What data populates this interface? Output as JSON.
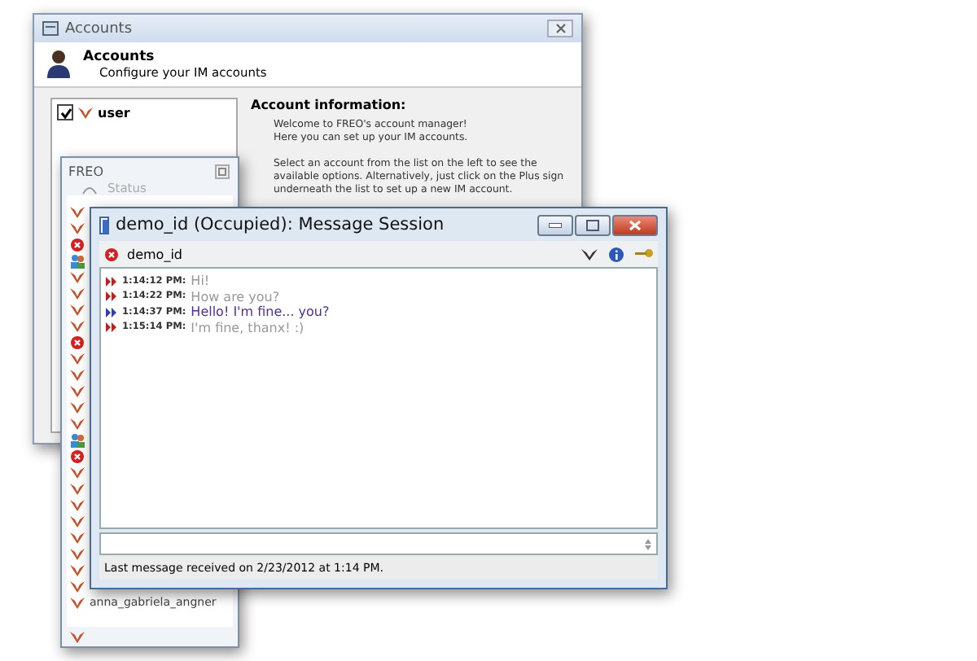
{
  "accounts_window": {
    "title": "Accounts",
    "header_title": "Accounts",
    "header_subtitle": "Configure your IM accounts",
    "accounts": [
      {
        "name": "user",
        "checked": true
      }
    ],
    "info_heading": "Account information:",
    "info_paragraphs": [
      "Welcome to FREO's account manager!\nHere you can set up your IM accounts.",
      "Select an account from the list on the left to see the available options. Alternatively, just click on the Plus sign underneath the list to set up a new IM account."
    ]
  },
  "contact_window": {
    "title": "FREO",
    "status_label": "Status",
    "contacts": [
      {
        "kind": "online"
      },
      {
        "kind": "online"
      },
      {
        "kind": "busy"
      },
      {
        "kind": "group"
      },
      {
        "kind": "online"
      },
      {
        "kind": "online"
      },
      {
        "kind": "online"
      },
      {
        "kind": "online"
      },
      {
        "kind": "busy"
      },
      {
        "kind": "online"
      },
      {
        "kind": "online"
      },
      {
        "kind": "online"
      },
      {
        "kind": "online"
      },
      {
        "kind": "online"
      },
      {
        "kind": "group"
      },
      {
        "kind": "busy"
      },
      {
        "kind": "online"
      },
      {
        "kind": "online"
      },
      {
        "kind": "online"
      },
      {
        "kind": "online"
      },
      {
        "kind": "online"
      },
      {
        "kind": "online"
      },
      {
        "kind": "online"
      },
      {
        "kind": "online"
      },
      {
        "kind": "online",
        "name": "anna_gabriela_angner"
      }
    ]
  },
  "chat_window": {
    "title": "demo_id (Occupied): Message Session",
    "contact": "demo_id",
    "messages": [
      {
        "kind": "in",
        "time": "1:14:12 PM:",
        "text": "Hi!"
      },
      {
        "kind": "in",
        "time": "1:14:22 PM:",
        "text": "How are you?"
      },
      {
        "kind": "out",
        "time": "1:14:37 PM:",
        "text": "Hello! I'm fine... you?"
      },
      {
        "kind": "in",
        "time": "1:15:14 PM:",
        "text": "I'm fine, thanx! :)"
      }
    ],
    "status_bar": "Last message received on 2/23/2012 at 1:14 PM."
  }
}
